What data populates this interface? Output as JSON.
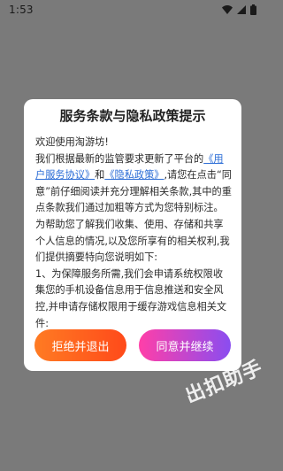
{
  "status_bar": {
    "time": "1:53",
    "icons": [
      "wifi-icon",
      "signal-icon",
      "battery-icon"
    ]
  },
  "dialog": {
    "title": "服务条款与隐私政策提示",
    "intro": "欢迎使用淘游坊!",
    "body_before_link1": "我们根据最新的监管要求更新了平台的",
    "link1": "《用户服务协议》",
    "body_between_links": "和",
    "link2": "《隐私政策》",
    "body_after_links": ",请您在点击“同意”前仔细阅读并充分理解相关条款,其中的重点条款我们通过加粗等方式为您特别标注。为帮助您了解我们收集、使用、存储和共享个人信息的情况,以及您所享有的相关权利,我们提供摘要特向您说明如下:",
    "point1": "1、为保障服务所需,我们会申请系统权限收集您的手机设备信息用于信息推送和安全风控,并申请存储权限用于缓存游戏信息相关文件:",
    "reject_label": "拒绝并退出",
    "agree_label": "同意并继续"
  },
  "watermark": "出扣助手",
  "colors": {
    "overlay": "#7a7a7a",
    "link": "#2a6cd6",
    "reject_gradient": [
      "#ff7b23",
      "#ff4a1a"
    ],
    "agree_gradient": [
      "#ff3fa8",
      "#8a4df0"
    ]
  }
}
